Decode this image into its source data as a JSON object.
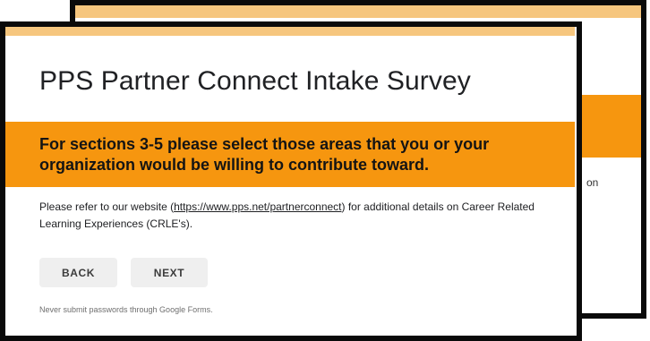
{
  "form": {
    "title": "PPS Partner Connect Intake Survey",
    "section_header": "For sections 3-5 please select those areas that you or your organization would be willing to contribute toward.",
    "description_prefix": "Please refer to our website (",
    "description_link": "https://www.pps.net/partnerconnect",
    "description_suffix": ") for additional details on Career Related Learning Experiences (CRLE's).",
    "back_label": "BACK",
    "next_label": "NEXT",
    "footer_note": "Never submit passwords through Google Forms."
  },
  "background_card": {
    "partial_text": "on"
  },
  "colors": {
    "accent_orange": "#f6960f",
    "accent_light": "#f6c67e",
    "border": "#0a0a0a"
  }
}
